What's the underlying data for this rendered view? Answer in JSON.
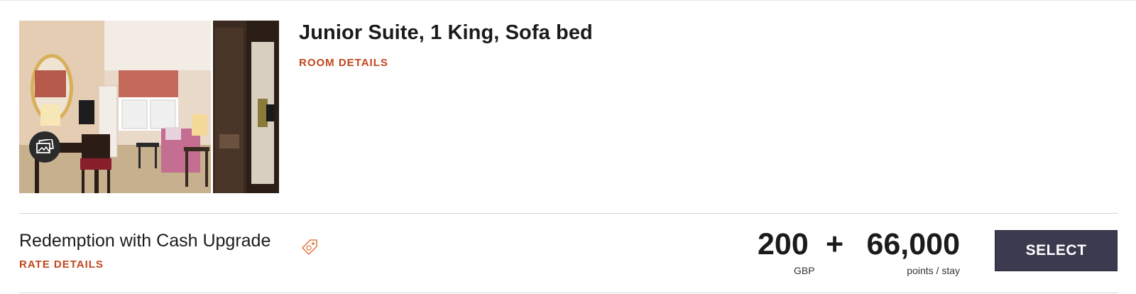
{
  "room": {
    "title": "Junior Suite, 1 King, Sofa bed",
    "details_link": "ROOM DETAILS",
    "photo_alt": "Junior Suite room photo"
  },
  "rate": {
    "name": "Redemption with Cash Upgrade",
    "details_link": "RATE DETAILS",
    "tag_icon": "price-tag-icon"
  },
  "price": {
    "cash": "200",
    "plus": "+",
    "points": "66,000",
    "currency": "GBP",
    "points_unit": "points / stay"
  },
  "actions": {
    "select_label": "SELECT"
  },
  "colors": {
    "accent": "#c1461c",
    "button": "#3c3a4f",
    "text": "#1b1b1b"
  }
}
